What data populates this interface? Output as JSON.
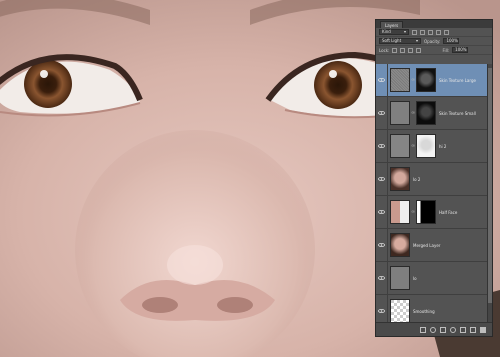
{
  "panel": {
    "tab_label": "Layers",
    "filter_kind": "Kind",
    "blend_mode": "Soft Light",
    "opacity_label": "Opacity:",
    "opacity_value": "100%",
    "lock_label": "Lock:",
    "fill_label": "Fill:",
    "fill_value": "100%",
    "layers": [
      {
        "name": "Skin Texture Large",
        "selected": true,
        "thumb": "gray-noise",
        "mask": "dark-face",
        "visible": true
      },
      {
        "name": "Skin Texture Small",
        "selected": false,
        "thumb": "gray",
        "mask": "dark-face",
        "visible": true
      },
      {
        "name": "hi 2",
        "selected": false,
        "thumb": "gray",
        "mask": "white-face",
        "visible": true
      },
      {
        "name": "lo 2",
        "selected": false,
        "thumb": "face",
        "mask": "",
        "visible": true
      },
      {
        "name": "Half Face",
        "selected": false,
        "thumb": "half-face",
        "mask": "black",
        "visible": true
      },
      {
        "name": "Merged Layer",
        "selected": false,
        "thumb": "face",
        "mask": "",
        "visible": true
      },
      {
        "name": "lo",
        "selected": false,
        "thumb": "gray",
        "mask": "",
        "visible": true
      },
      {
        "name": "Smoothing",
        "selected": false,
        "thumb": "transparent",
        "mask": "",
        "visible": true
      }
    ],
    "footer_icons": [
      "link-icon",
      "fx-icon",
      "mask-icon",
      "adjustment-icon",
      "group-icon",
      "new-layer-icon",
      "trash-icon"
    ]
  },
  "colors": {
    "selected_layer": "#6f8fb5",
    "panel_bg": "#535353",
    "skin": "#d9b8ae",
    "iris": "#7a4a2a"
  }
}
